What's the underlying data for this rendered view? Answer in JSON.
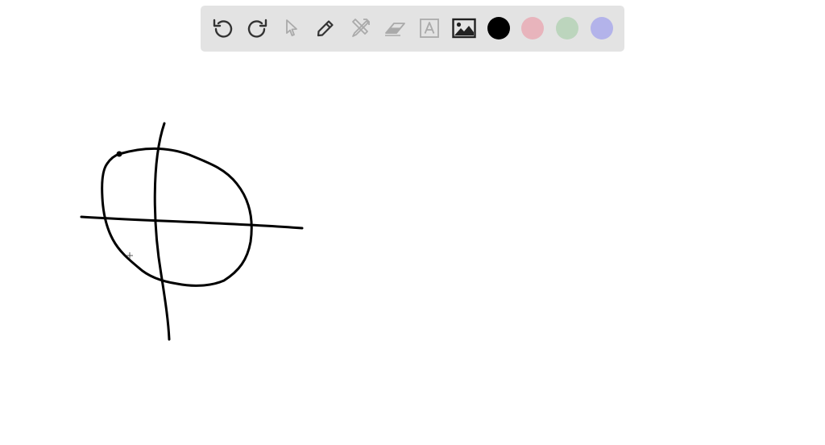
{
  "toolbar": {
    "tools": [
      {
        "name": "undo",
        "icon": "undo-icon",
        "enabled": true
      },
      {
        "name": "redo",
        "icon": "redo-icon",
        "enabled": true
      },
      {
        "name": "select",
        "icon": "pointer-icon",
        "enabled": false
      },
      {
        "name": "pen",
        "icon": "pencil-icon",
        "enabled": true
      },
      {
        "name": "tools",
        "icon": "hammer-wrench-icon",
        "enabled": false
      },
      {
        "name": "eraser",
        "icon": "eraser-icon",
        "enabled": false
      },
      {
        "name": "text",
        "icon": "text-box-icon",
        "enabled": false
      },
      {
        "name": "image",
        "icon": "image-icon",
        "enabled": true
      }
    ],
    "colors": [
      {
        "name": "black",
        "hex": "#000000",
        "selected": true
      },
      {
        "name": "pink",
        "hex": "#e8b4bc",
        "selected": false
      },
      {
        "name": "green",
        "hex": "#bcd5bd",
        "selected": false
      },
      {
        "name": "purple",
        "hex": "#b3b3ea",
        "selected": false
      }
    ]
  },
  "colors": {
    "toolbar_bg": "#e3e3e3",
    "icon_active": "#333333",
    "icon_disabled": "#aaaaaa",
    "ink": "#000000"
  }
}
